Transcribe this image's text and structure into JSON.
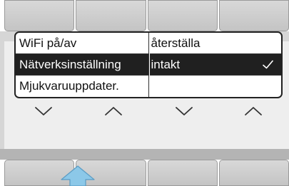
{
  "menu": {
    "left_column": [
      {
        "label": "WiFi på/av"
      },
      {
        "label": "Nätverksinställning",
        "selected": true
      },
      {
        "label": "Mjukvaruuppdater."
      }
    ],
    "right_column": [
      {
        "label": "återställa"
      },
      {
        "label": "intakt",
        "selected": true,
        "icon": "check-icon"
      },
      {
        "label": ""
      }
    ]
  },
  "navigation_arrows": [
    "chevron-down-icon",
    "chevron-up-icon",
    "chevron-down-icon",
    "chevron-up-icon"
  ],
  "pointer": {
    "icon": "up-arrow-icon",
    "color": "#8cc8e8",
    "target_softkey": 1
  },
  "colors": {
    "panel": "#d6d6d6",
    "selection": "#202020",
    "softkey": "#c8c8c8"
  }
}
